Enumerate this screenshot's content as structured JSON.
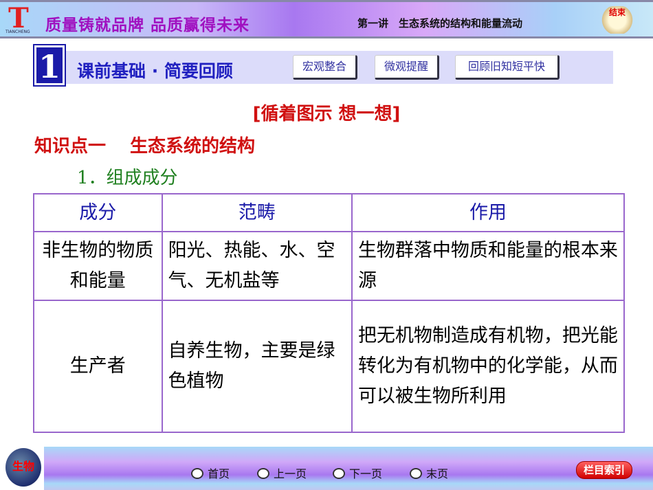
{
  "header": {
    "logo_text": "TIANCHENG",
    "slogan": "质量铸就品牌 品质赢得未来",
    "chapter": "第一讲　生态系统的结构和能量流动",
    "end_button": "结束"
  },
  "banner": {
    "number": "1",
    "title": "课前基础 · 简要回顾",
    "buttons": [
      "宏观整合",
      "微观提醒",
      "回顾旧知短平快"
    ]
  },
  "subtitle": "[循着图示 想一想]",
  "knowledge_point": "知识点一 生态系统的结构",
  "section": "1．组成成分",
  "table": {
    "headers": [
      "成分",
      "范畴",
      "作用"
    ],
    "rows": [
      [
        "非生物的物质和能量",
        "阳光、热能、水、空气、无机盐等",
        "生物群落中物质和能量的根本来源"
      ],
      [
        "生产者",
        "自养生物，主要是绿色植物",
        "把无机物制造成有机物，把光能转化为有机物中的化学能，从而可以被生物所利用"
      ]
    ]
  },
  "footer": {
    "subject": "生物",
    "nav": [
      "首页",
      "上一页",
      "下一页",
      "末页"
    ],
    "index_button": "栏目索引"
  }
}
